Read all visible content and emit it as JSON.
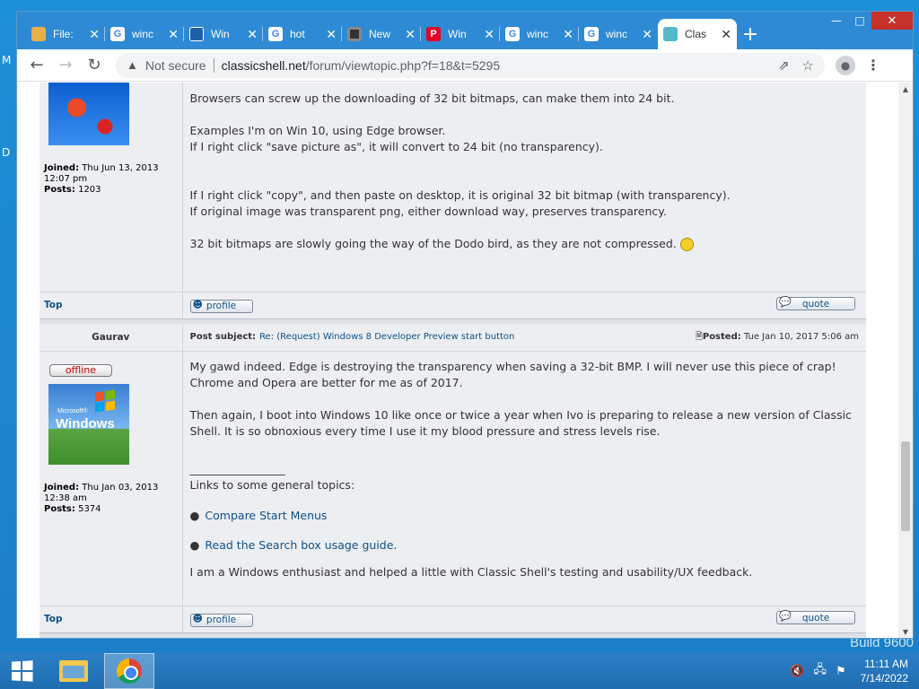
{
  "desktop": {
    "letters": [
      "M",
      "D"
    ],
    "build_text": "Build 9600"
  },
  "window": {
    "minimize": "—",
    "maximize": "□",
    "close": "✕"
  },
  "tabs": [
    {
      "title": "File:",
      "icon": "file-explorer-favicon"
    },
    {
      "title": "winc",
      "icon": "google-favicon"
    },
    {
      "title": "Win",
      "icon": "windows-favicon"
    },
    {
      "title": "hot",
      "icon": "google-favicon"
    },
    {
      "title": "New",
      "icon": "new-tab-favicon"
    },
    {
      "title": "Win",
      "icon": "pinterest-favicon"
    },
    {
      "title": "winc",
      "icon": "google-favicon"
    },
    {
      "title": "winc",
      "icon": "google-favicon"
    },
    {
      "title": "Clas",
      "icon": "classic-shell-favicon",
      "active": true
    }
  ],
  "tab_close": "✕",
  "new_tab": "+",
  "toolbar": {
    "back": "←",
    "forward": "→",
    "reload": "↻",
    "security_label": "Not secure",
    "url_host": "classicshell.net",
    "url_path": "/forum/viewtopic.php?f=18&t=5295",
    "share": "⇗",
    "star": "☆",
    "menu": "⋮"
  },
  "post1": {
    "body": [
      "Browsers can screw up the downloading of 32 bit bitmaps, can make them into 24 bit.",
      "",
      "Examples I'm on Win 10, using Edge browser.",
      "If I right click \"save picture as\", it will convert to 24 bit (no transparency).",
      "",
      "",
      "If I right click \"copy\", and then paste on desktop, it is original 32 bit bitmap (with transparency).",
      "If original image was transparent png, either download way, preserves transparency.",
      "",
      "32 bit bitmaps are slowly going the way of the Dodo bird, as they are not compressed."
    ],
    "joined_label": "Joined:",
    "joined": "Thu Jun 13, 2013 12:07 pm",
    "posts_label": "Posts:",
    "posts": "1203",
    "top_link": "Top",
    "profile_btn": "profile",
    "quote_btn": "quote"
  },
  "post2": {
    "author": "Gaurav",
    "subject_label": "Post subject:",
    "subject": "Re: (Request) Windows 8 Developer Preview start button",
    "posted_label": "Posted:",
    "posted": "Tue Jan 10, 2017 5:06 am",
    "status": "offline",
    "avatar_ms": "Microsoft®",
    "avatar_text": "Windows",
    "paragraph1": "My gawd indeed. Edge is destroying the transparency when saving a 32-bit BMP. I will never use this piece of crap! Chrome and Opera are better for me as of 2017.",
    "paragraph2": "Then again, I boot into Windows 10 like once or twice a year when Ivo is preparing to release a new version of Classic Shell. It is so obnoxious every time I use it my blood pressure and stress levels rise.",
    "signature_rule": "_________________",
    "links_intro": "Links to some general topics:",
    "links": [
      "Compare Start Menus",
      "Read the Search box usage guide."
    ],
    "closing": "I am a Windows enthusiast and helped a little with Classic Shell's testing and usability/UX feedback.",
    "joined_label": "Joined:",
    "joined": "Thu Jan 03, 2013 12:38 am",
    "posts_label": "Posts:",
    "posts": "5374",
    "top_link": "Top",
    "profile_btn": "profile",
    "quote_btn": "quote"
  },
  "taskbar": {
    "time": "11:11 AM",
    "date": "7/14/2022"
  }
}
